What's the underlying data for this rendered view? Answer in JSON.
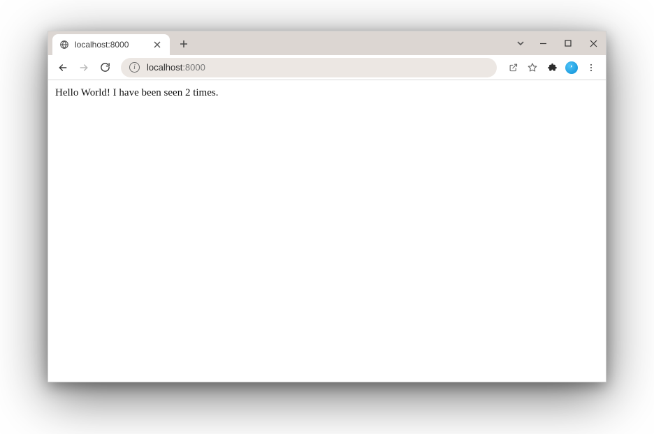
{
  "tab": {
    "title": "localhost:8000",
    "favicon_name": "globe-icon"
  },
  "address": {
    "host": "localhost",
    "port": ":8000"
  },
  "page": {
    "body_text": "Hello World! I have been seen 2 times."
  }
}
